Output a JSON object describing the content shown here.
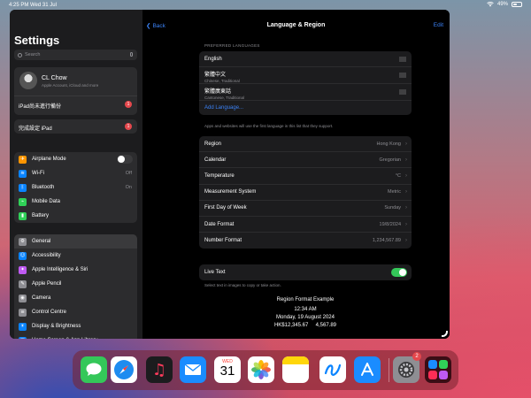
{
  "status": {
    "time": "4:25 PM",
    "date": "Wed 31 Jul",
    "battery": "49%",
    "battery_level": 0.49
  },
  "sidebar": {
    "title": "Settings",
    "search_placeholder": "Search",
    "profile": {
      "name": "CL Chow",
      "subtitle": "Apple Account, iCloud and more"
    },
    "backup": {
      "label": "iPad尚未進行備份",
      "badge": "1"
    },
    "setup": {
      "label": "完成設定 iPad",
      "badge": "1"
    },
    "connectivity": [
      {
        "label": "Airplane Mode",
        "icon": "airplane-icon",
        "color": "#ff9500",
        "glyph": "✈",
        "value": ""
      },
      {
        "label": "Wi-Fi",
        "icon": "wifi-icon",
        "color": "#0a84ff",
        "glyph": "≋",
        "value": "Off"
      },
      {
        "label": "Bluetooth",
        "icon": "bluetooth-icon",
        "color": "#0a84ff",
        "glyph": "ᛒ",
        "value": "On"
      },
      {
        "label": "Mobile Data",
        "icon": "mobile-data-icon",
        "color": "#30d158",
        "glyph": "⌁",
        "value": ""
      },
      {
        "label": "Battery",
        "icon": "battery-icon",
        "color": "#30d158",
        "glyph": "▮",
        "value": ""
      }
    ],
    "system": [
      {
        "label": "General",
        "icon": "gear-icon",
        "color": "#8e8e93",
        "glyph": "⚙",
        "selected": true
      },
      {
        "label": "Accessibility",
        "icon": "accessibility-icon",
        "color": "#0a84ff",
        "glyph": "☺",
        "selected": false
      },
      {
        "label": "Apple Intelligence & Siri",
        "icon": "siri-icon",
        "color": "#bf5af2",
        "glyph": "✦",
        "selected": false
      },
      {
        "label": "Apple Pencil",
        "icon": "pencil-icon",
        "color": "#8e8e93",
        "glyph": "✎",
        "selected": false
      },
      {
        "label": "Camera",
        "icon": "camera-icon",
        "color": "#8e8e93",
        "glyph": "◉",
        "selected": false
      },
      {
        "label": "Control Centre",
        "icon": "control-centre-icon",
        "color": "#8e8e93",
        "glyph": "≡",
        "selected": false
      },
      {
        "label": "Display & Brightness",
        "icon": "brightness-icon",
        "color": "#0a84ff",
        "glyph": "☀",
        "selected": false
      },
      {
        "label": "Home Screen & App Library",
        "icon": "home-screen-icon",
        "color": "#0a84ff",
        "glyph": "▦",
        "selected": false
      }
    ]
  },
  "detail": {
    "back_label": "Back",
    "title": "Language & Region",
    "edit_label": "Edit",
    "preferred_header": "PREFERRED LANGUAGES",
    "languages": [
      {
        "name": "English",
        "sub": ""
      },
      {
        "name": "繁體中文",
        "sub": "Chinese, Traditional"
      },
      {
        "name": "繁體廣東話",
        "sub": "Cantonese, Traditional"
      }
    ],
    "add_language": "Add Language...",
    "languages_note": "Apps and websites will use the first language in this list that they support.",
    "settings": [
      {
        "label": "Region",
        "value": "Hong Kong"
      },
      {
        "label": "Calendar",
        "value": "Gregorian"
      },
      {
        "label": "Temperature",
        "value": "°C"
      },
      {
        "label": "Measurement System",
        "value": "Metric"
      },
      {
        "label": "First Day of Week",
        "value": "Sunday"
      },
      {
        "label": "Date Format",
        "value": "19/8/2024"
      },
      {
        "label": "Number Format",
        "value": "1,234,567.89"
      }
    ],
    "live_text": {
      "label": "Live Text",
      "enabled": true,
      "note": "Select text in images to copy or take action."
    },
    "example": {
      "title": "Region Format Example",
      "time": "12:34 AM",
      "date": "Monday, 19 August 2024",
      "numbers": "HK$12,345.67     4,567.89"
    }
  },
  "dock": {
    "calendar_day": "WED",
    "calendar_date": "31",
    "settings_badge": "2",
    "apps": [
      {
        "name": "Messages",
        "icon": "messages-icon"
      },
      {
        "name": "Safari",
        "icon": "safari-icon"
      },
      {
        "name": "Music",
        "icon": "music-icon"
      },
      {
        "name": "Mail",
        "icon": "mail-icon"
      },
      {
        "name": "Calendar",
        "icon": "calendar-icon"
      },
      {
        "name": "Photos",
        "icon": "photos-icon"
      },
      {
        "name": "Notes",
        "icon": "notes-icon"
      },
      {
        "name": "Freeform",
        "icon": "freeform-icon"
      },
      {
        "name": "App Store",
        "icon": "app-store-icon"
      },
      {
        "name": "Settings",
        "icon": "settings-icon"
      },
      {
        "name": "App Library",
        "icon": "app-library-icon"
      }
    ]
  }
}
